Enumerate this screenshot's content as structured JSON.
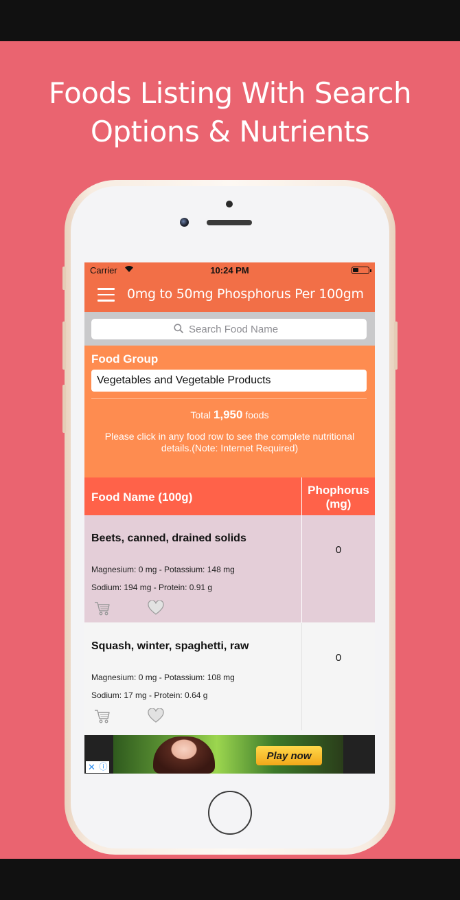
{
  "promo": {
    "headline_line1": "Foods Listing With Search",
    "headline_line2": "Options & Nutrients"
  },
  "status_bar": {
    "carrier": "Carrier",
    "time": "10:24 PM"
  },
  "navbar": {
    "title": "0mg to 50mg Phosphorus Per 100gm",
    "menu_icon": "hamburger-menu-icon"
  },
  "search": {
    "placeholder": "Search Food Name",
    "icon": "search-icon"
  },
  "filter": {
    "food_group_label": "Food Group",
    "food_group_value": "Vegetables and Vegetable Products",
    "total_prefix": "Total",
    "total_count": "1,950",
    "total_suffix": "foods",
    "note": "Please click in any food row to see the complete nutritional details.(Note: Internet Required)"
  },
  "table": {
    "header_name": "Food Name (100g)",
    "header_value": "Phophorus (mg)",
    "rows": [
      {
        "name": "Beets, canned, drained solids",
        "line1": "Magnesium: 0 mg - Potassium: 148 mg",
        "line2": "Sodium: 194 mg - Protein: 0.91 g",
        "value": "0"
      },
      {
        "name": "Squash, winter, spaghetti, raw",
        "line1": "Magnesium: 0 mg - Potassium: 108 mg",
        "line2": "Sodium: 17 mg - Protein: 0.64 g",
        "value": "0"
      }
    ]
  },
  "ad": {
    "cta": "Play now",
    "close_symbol": "✕",
    "info_symbol": "ⓘ"
  },
  "colors": {
    "background_pink": "#ea6470",
    "navbar": "#f26f47",
    "filter_panel": "#fe8c50",
    "table_header": "#ff6249",
    "row_alt": "#e4ced8",
    "row_default": "#f5f5f5"
  }
}
